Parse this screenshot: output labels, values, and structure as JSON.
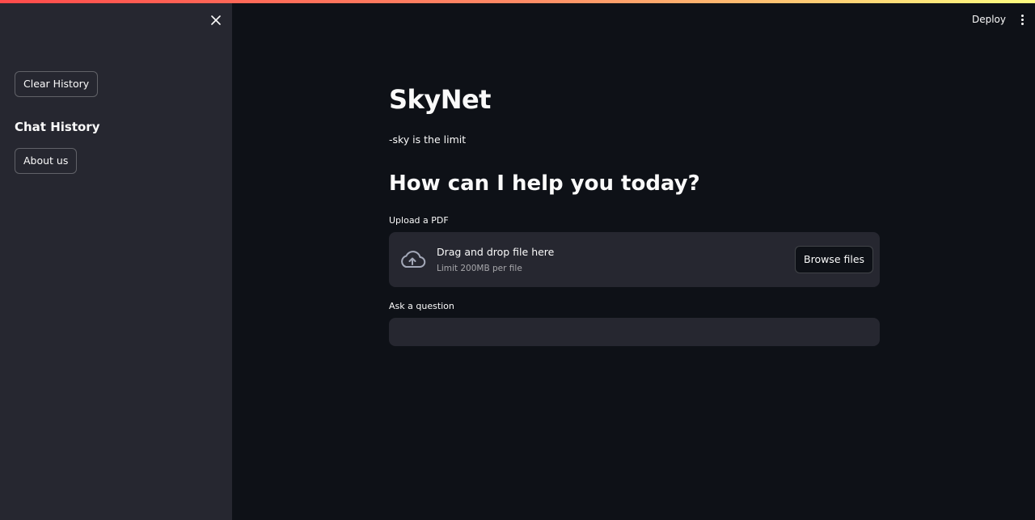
{
  "colors": {
    "background": "#0e1117",
    "sidebar": "#262730",
    "text": "#fafafa",
    "accent_gradient_start": "#ff4b4b",
    "accent_gradient_end": "#fffd80"
  },
  "sidebar": {
    "close_icon": "close-icon",
    "clear_history_label": "Clear History",
    "chat_history_heading": "Chat History",
    "about_label": "About us"
  },
  "header": {
    "deploy_label": "Deploy",
    "menu_icon": "kebab-menu-icon"
  },
  "main": {
    "title": "SkyNet",
    "tagline": "-sky is the limit",
    "heading": "How can I help you today?",
    "upload": {
      "label": "Upload a PDF",
      "icon": "cloud-upload-icon",
      "drop_text": "Drag and drop file here",
      "limit_text": "Limit 200MB per file",
      "browse_label": "Browse files"
    },
    "question": {
      "label": "Ask a question",
      "value": "",
      "placeholder": ""
    }
  }
}
